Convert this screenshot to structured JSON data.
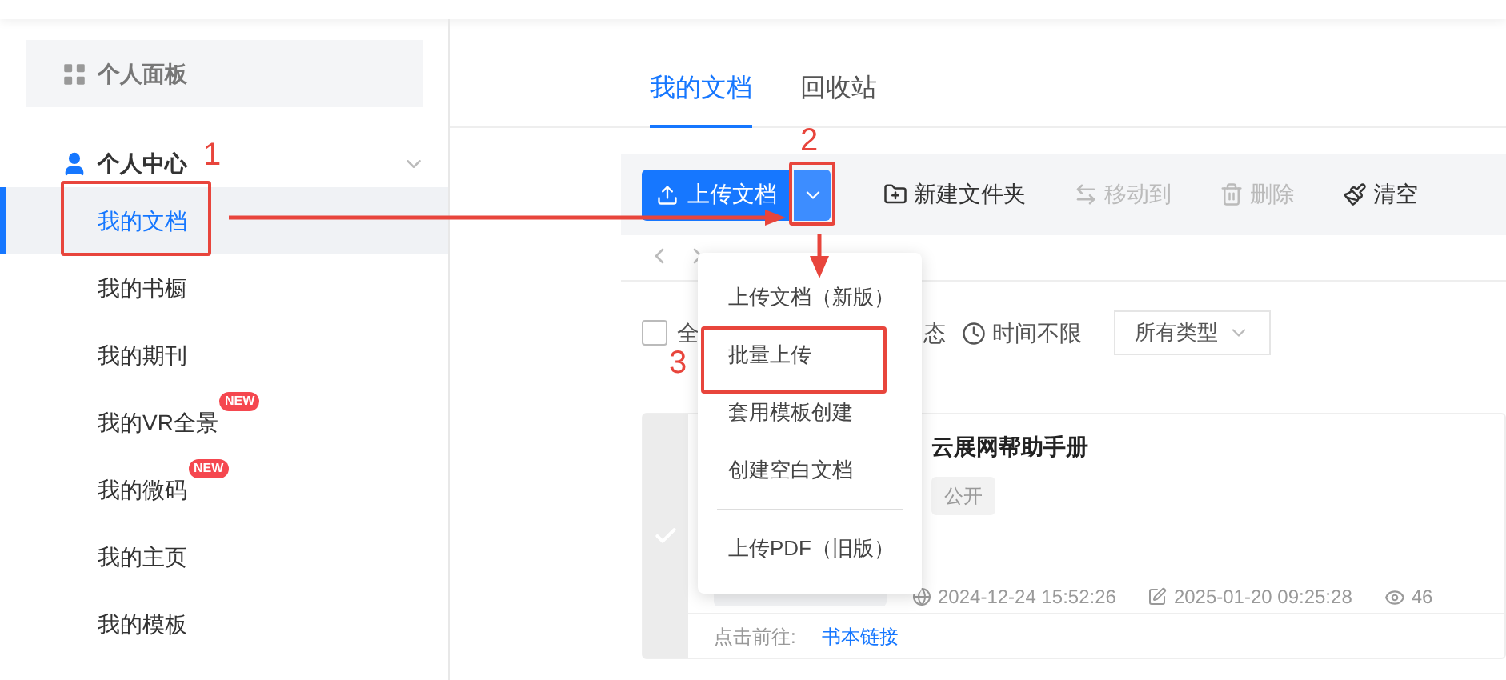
{
  "sidebar": {
    "panel": {
      "label": "个人面板"
    },
    "group": {
      "label": "个人中心",
      "expanded": true
    },
    "items": [
      {
        "label": "我的文档",
        "selected": true
      },
      {
        "label": "我的书橱",
        "selected": false
      },
      {
        "label": "我的期刊",
        "selected": false
      },
      {
        "label": "我的VR全景",
        "selected": false,
        "badge": "NEW"
      },
      {
        "label": "我的微码",
        "selected": false,
        "badge": "NEW"
      },
      {
        "label": "我的主页",
        "selected": false
      },
      {
        "label": "我的模板",
        "selected": false
      }
    ]
  },
  "tabs": [
    {
      "label": "我的文档",
      "selected": true
    },
    {
      "label": "回收站",
      "selected": false
    }
  ],
  "toolbar": {
    "upload": "上传文档",
    "actions": [
      {
        "label": "新建文件夹",
        "disabled": false
      },
      {
        "label": "移动到",
        "disabled": true
      },
      {
        "label": "删除",
        "disabled": true
      },
      {
        "label": "清空",
        "disabled": false
      }
    ]
  },
  "filters": {
    "select_all": "全",
    "checked": false,
    "status": "态",
    "time": "时间不限",
    "type": "所有类型"
  },
  "document": {
    "title": "云展网帮助手册",
    "tag": "公开",
    "created": "2024-12-24 15:52:26",
    "modified": "2025-01-20 09:25:28",
    "views": "46",
    "footer_label": "点击前往:",
    "footer_link": "书本链接",
    "selected": false
  },
  "menu": [
    {
      "label": "上传文档（新版）",
      "kind": "item"
    },
    {
      "label": "批量上传",
      "kind": "item"
    },
    {
      "label": "套用模板创建",
      "kind": "item"
    },
    {
      "label": "创建空白文档",
      "kind": "item"
    },
    {
      "kind": "divider"
    },
    {
      "label": "上传PDF（旧版）",
      "kind": "item"
    }
  ],
  "annotations": [
    "1",
    "2",
    "3"
  ]
}
